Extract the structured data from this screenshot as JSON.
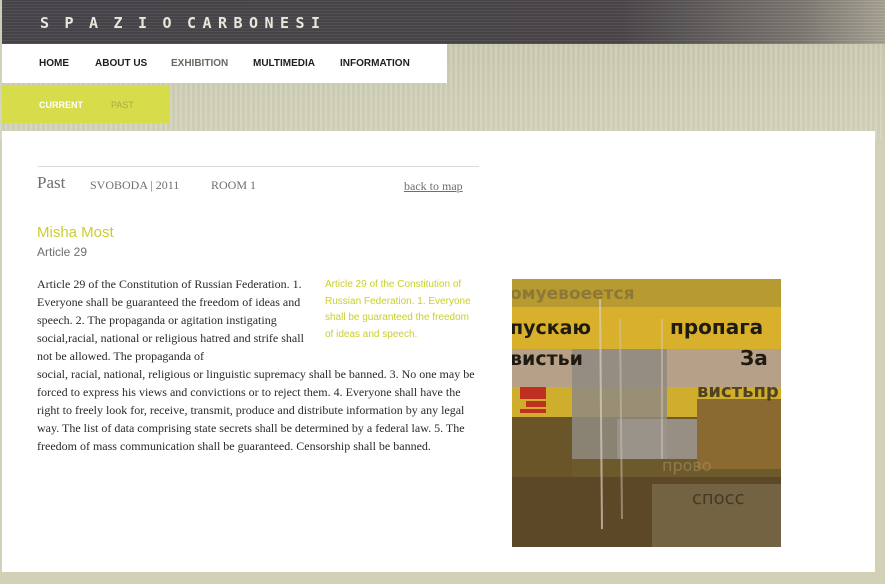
{
  "header": {
    "logo_chars": [
      "S",
      "P",
      "A",
      "Z",
      "I",
      "O",
      "C",
      "A",
      "R",
      "B",
      "O",
      "N",
      "E",
      "S",
      "I"
    ]
  },
  "nav": {
    "items": [
      {
        "label": "HOME"
      },
      {
        "label": "ABOUT US"
      },
      {
        "label": "EXHIBITION"
      },
      {
        "label": "MULTIMEDIA"
      },
      {
        "label": "INFORMATION"
      }
    ]
  },
  "subnav": {
    "current_label": "CURRENT",
    "past_label": "PAST"
  },
  "breadcrumb": {
    "section": "Past",
    "exhibition": "SVOBODA | 2011",
    "room": "ROOM 1",
    "back_link": "back to map"
  },
  "artwork": {
    "artist": "Misha Most",
    "title": "Article 29",
    "description_first_lines": "Article 29 of the Constitution of Russian Federation. 1. Everyone shall be guaranteed the freedom of ideas and speech. 2. The propaganda or agitation instigating social,racial, national or religious hatred and strife shall not be allowed. The propaganda of",
    "description_rest": "social, racial, national, religious or linguistic supremacy shall be banned. 3. No one may be forced to express his views and convictions or to reject them. 4. Everyone shall have the right to freely look for, receive, transmit, produce and distribute information by any legal way. The list of data comprising state secrets shall be determined by a federal law. 5. The freedom of mass communication shall be guaranteed. Censorship shall be banned.",
    "pull_quote": "Article 29 of the Constitution of Russian Federation. 1. Everyone shall be guaranteed the freedom of ideas and speech.",
    "image_text": [
      "омуевоеется",
      "пускаю",
      "пропага",
      "вистьи",
      "За",
      "вистьпр",
      "прово",
      "спосс"
    ]
  },
  "colors": {
    "accent": "#c9cf2e",
    "header_bg": "#4a474c",
    "page_bg": "#d2d1b8"
  }
}
